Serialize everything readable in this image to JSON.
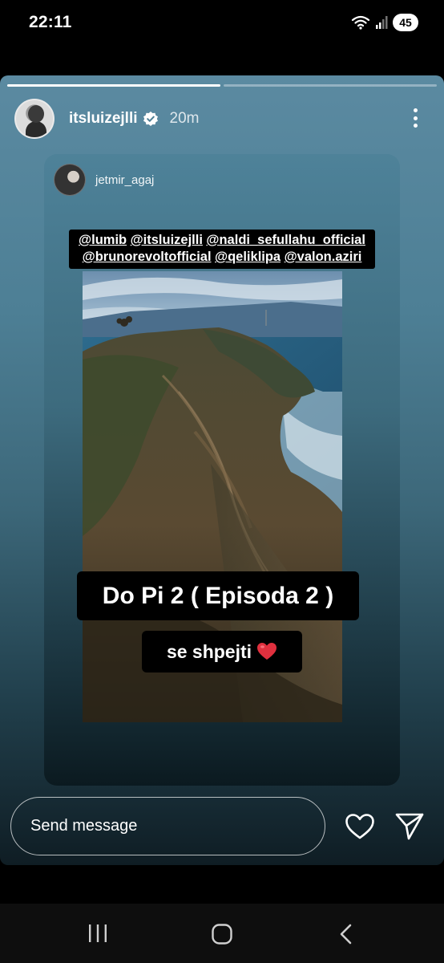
{
  "status_bar": {
    "time": "22:11",
    "battery": "45"
  },
  "story": {
    "progress": [
      1.0,
      0.0
    ],
    "author": {
      "username": "itsluizejlli",
      "verified": true,
      "time_ago": "20m"
    },
    "reshared_post": {
      "username": "jetmir_agaj",
      "mentions": [
        "@lumib",
        "@itsluizejlli",
        "@naldi_sefullahu_official",
        "@brunorevoltofficial",
        "@qeliklipa",
        "@valon.aziri"
      ],
      "caption_main": "Do Pi 2 ( Episoda 2 )",
      "caption_sub": "se shpejti",
      "caption_emoji_icon": "red-heart-icon"
    }
  },
  "reply": {
    "placeholder": "Send message"
  },
  "icons": {
    "more": "more-vertical-icon",
    "like": "heart-outline-icon",
    "send": "paper-plane-icon",
    "nav": [
      "recent-apps-icon",
      "home-icon",
      "back-icon"
    ]
  },
  "colors": {
    "heart": "#e0303e",
    "story_bg": "#4d7f95"
  }
}
